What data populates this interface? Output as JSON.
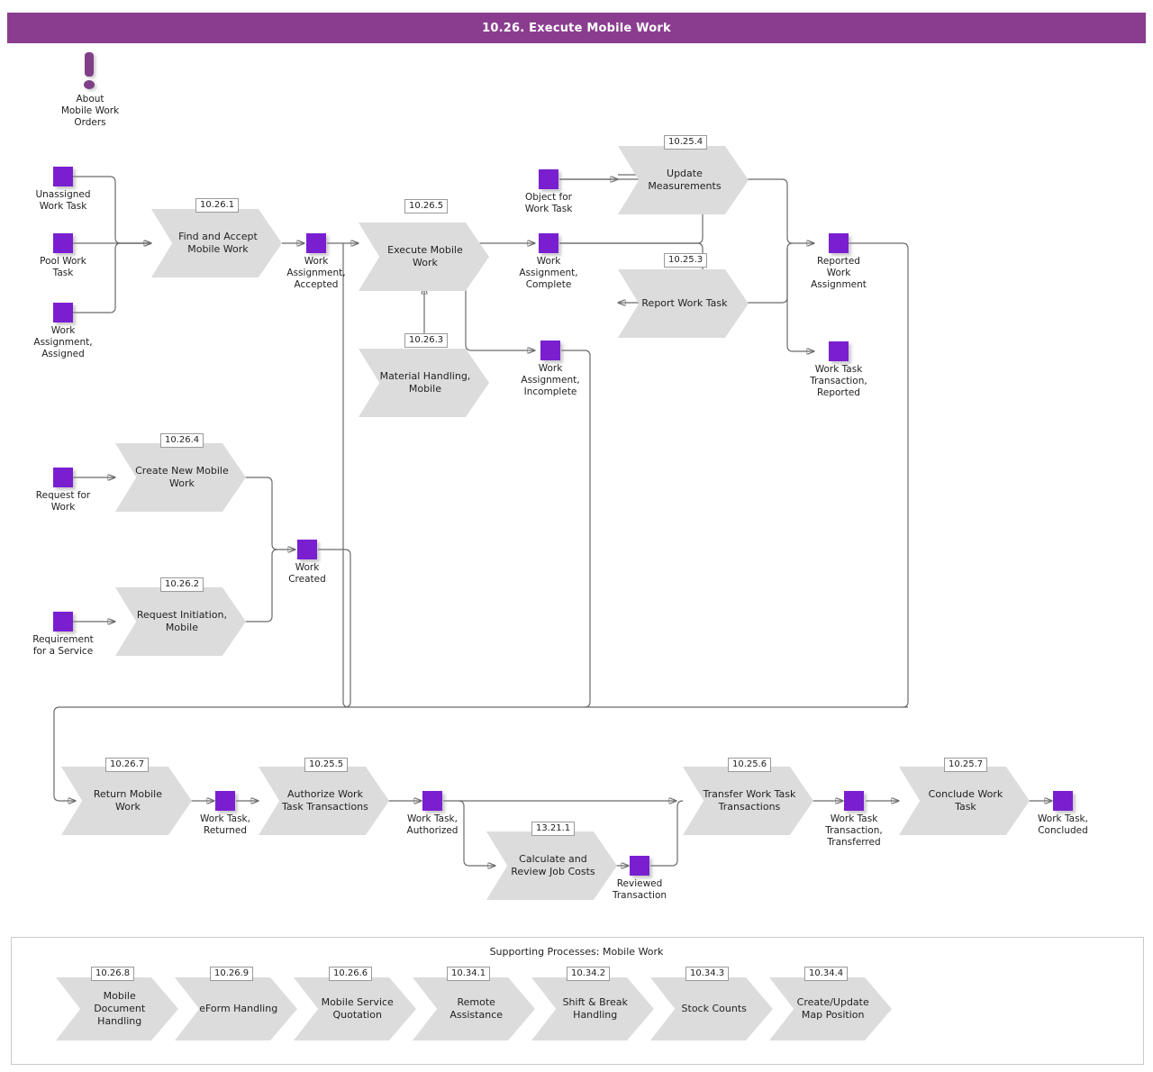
{
  "header": {
    "title": "10.26. Execute Mobile Work",
    "bar_color": "#8A3D8F"
  },
  "colors": {
    "entity": "#7A1FD0",
    "process": "#DCDCDC",
    "connector": "#6B6B6B",
    "about_icon": "#803F87"
  },
  "about": {
    "icon": "exclamation-icon",
    "label": "About\nMobile Work\nOrders"
  },
  "entities": [
    {
      "key": "unassigned_work_task",
      "label": "Unassigned\nWork Task"
    },
    {
      "key": "pool_work_task",
      "label": "Pool Work\nTask"
    },
    {
      "key": "work_assignment_assigned",
      "label": "Work\nAssignment,\nAssigned"
    },
    {
      "key": "work_assignment_accepted",
      "label": "Work\nAssignment,\nAccepted"
    },
    {
      "key": "object_for_work_task",
      "label": "Object for\nWork Task"
    },
    {
      "key": "work_assignment_complete",
      "label": "Work\nAssignment,\nComplete"
    },
    {
      "key": "work_assignment_incomplete",
      "label": "Work\nAssignment,\nIncomplete"
    },
    {
      "key": "reported_work_assignment",
      "label": "Reported\nWork\nAssignment"
    },
    {
      "key": "work_task_transaction_reported",
      "label": "Work Task\nTransaction,\nReported"
    },
    {
      "key": "request_for_work",
      "label": "Request for\nWork"
    },
    {
      "key": "requirement_for_a_service",
      "label": "Requirement\nfor a Service"
    },
    {
      "key": "work_created",
      "label": "Work\nCreated"
    },
    {
      "key": "work_task_returned",
      "label": "Work Task,\nReturned"
    },
    {
      "key": "work_task_authorized",
      "label": "Work Task,\nAuthorized"
    },
    {
      "key": "reviewed_transaction",
      "label": "Reviewed\nTransaction"
    },
    {
      "key": "work_task_transaction_transferred",
      "label": "Work Task\nTransaction,\nTransferred"
    },
    {
      "key": "work_task_concluded",
      "label": "Work Task,\nConcluded"
    }
  ],
  "processes": [
    {
      "key": "find_and_accept_mobile_work",
      "id": "10.26.1",
      "label": "Find and Accept\nMobile Work"
    },
    {
      "key": "execute_mobile_work",
      "id": "10.26.5",
      "label": "Execute Mobile\nWork"
    },
    {
      "key": "material_handling_mobile",
      "id": "10.26.3",
      "label": "Material\nHandling, Mobile"
    },
    {
      "key": "update_measurements",
      "id": "10.25.4",
      "label": "Update\nMeasurements"
    },
    {
      "key": "report_work_task",
      "id": "10.25.3",
      "label": "Report Work\nTask"
    },
    {
      "key": "create_new_mobile_work",
      "id": "10.26.4",
      "label": "Create New\nMobile Work"
    },
    {
      "key": "request_initiation_mobile",
      "id": "10.26.2",
      "label": "Request\nInitiation, Mobile"
    },
    {
      "key": "return_mobile_work",
      "id": "10.26.7",
      "label": "Return Mobile\nWork"
    },
    {
      "key": "authorize_work_task_transactions",
      "id": "10.25.5",
      "label": "Authorize Work\nTask\nTransactions"
    },
    {
      "key": "calculate_and_review_job_costs",
      "id": "13.21.1",
      "label": "Calculate and\nReview Job\nCosts"
    },
    {
      "key": "transfer_work_task_transactions",
      "id": "10.25.6",
      "label": "Transfer Work\nTask\nTransactions"
    },
    {
      "key": "conclude_work_task",
      "id": "10.25.7",
      "label": "Conclude Work\nTask"
    }
  ],
  "supporting": {
    "caption": "Supporting Processes: Mobile Work",
    "items": [
      {
        "key": "mobile_document_handling",
        "id": "10.26.8",
        "label": "Mobile\nDocument\nHandling"
      },
      {
        "key": "eform_handling",
        "id": "10.26.9",
        "label": "eForm Handling"
      },
      {
        "key": "mobile_service_quotation",
        "id": "10.26.6",
        "label": "Mobile Service\nQuotation"
      },
      {
        "key": "remote_assistance",
        "id": "10.34.1",
        "label": "Remote\nAssistance"
      },
      {
        "key": "shift_break_handling",
        "id": "10.34.2",
        "label": "Shift & Break\nHandling"
      },
      {
        "key": "stock_counts",
        "id": "10.34.3",
        "label": "Stock Counts"
      },
      {
        "key": "create_update_map_position",
        "id": "10.34.4",
        "label": "Create/Update\nMap Position"
      }
    ]
  }
}
